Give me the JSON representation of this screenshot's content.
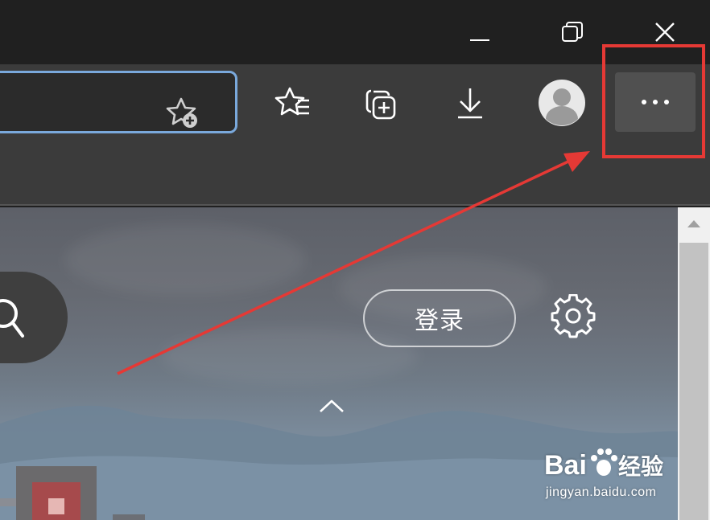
{
  "window": {
    "controls": [
      "minimize",
      "restore",
      "close"
    ]
  },
  "toolbar": {
    "address_bar_value": "",
    "icons": [
      "add-favorite-icon",
      "favorites-icon",
      "collections-icon",
      "downloads-icon",
      "profile-avatar",
      "more-icon"
    ]
  },
  "page": {
    "login_label": "登录",
    "icons": [
      "search-icon",
      "settings-icon",
      "collapse-icon"
    ]
  },
  "annotation": {
    "highlight_color": "#e53935",
    "arrow_color": "#e53935"
  },
  "watermark": {
    "brand": "Baidu经验",
    "url": "jingyan.baidu.com"
  },
  "colors": {
    "titlebar": "#202020",
    "toolbar": "#3b3b3b",
    "address_border": "#7aa9dc",
    "more_button": "#505050",
    "scrollbar_track": "#f0f0f0",
    "scrollbar_thumb": "#c2c2c2"
  }
}
